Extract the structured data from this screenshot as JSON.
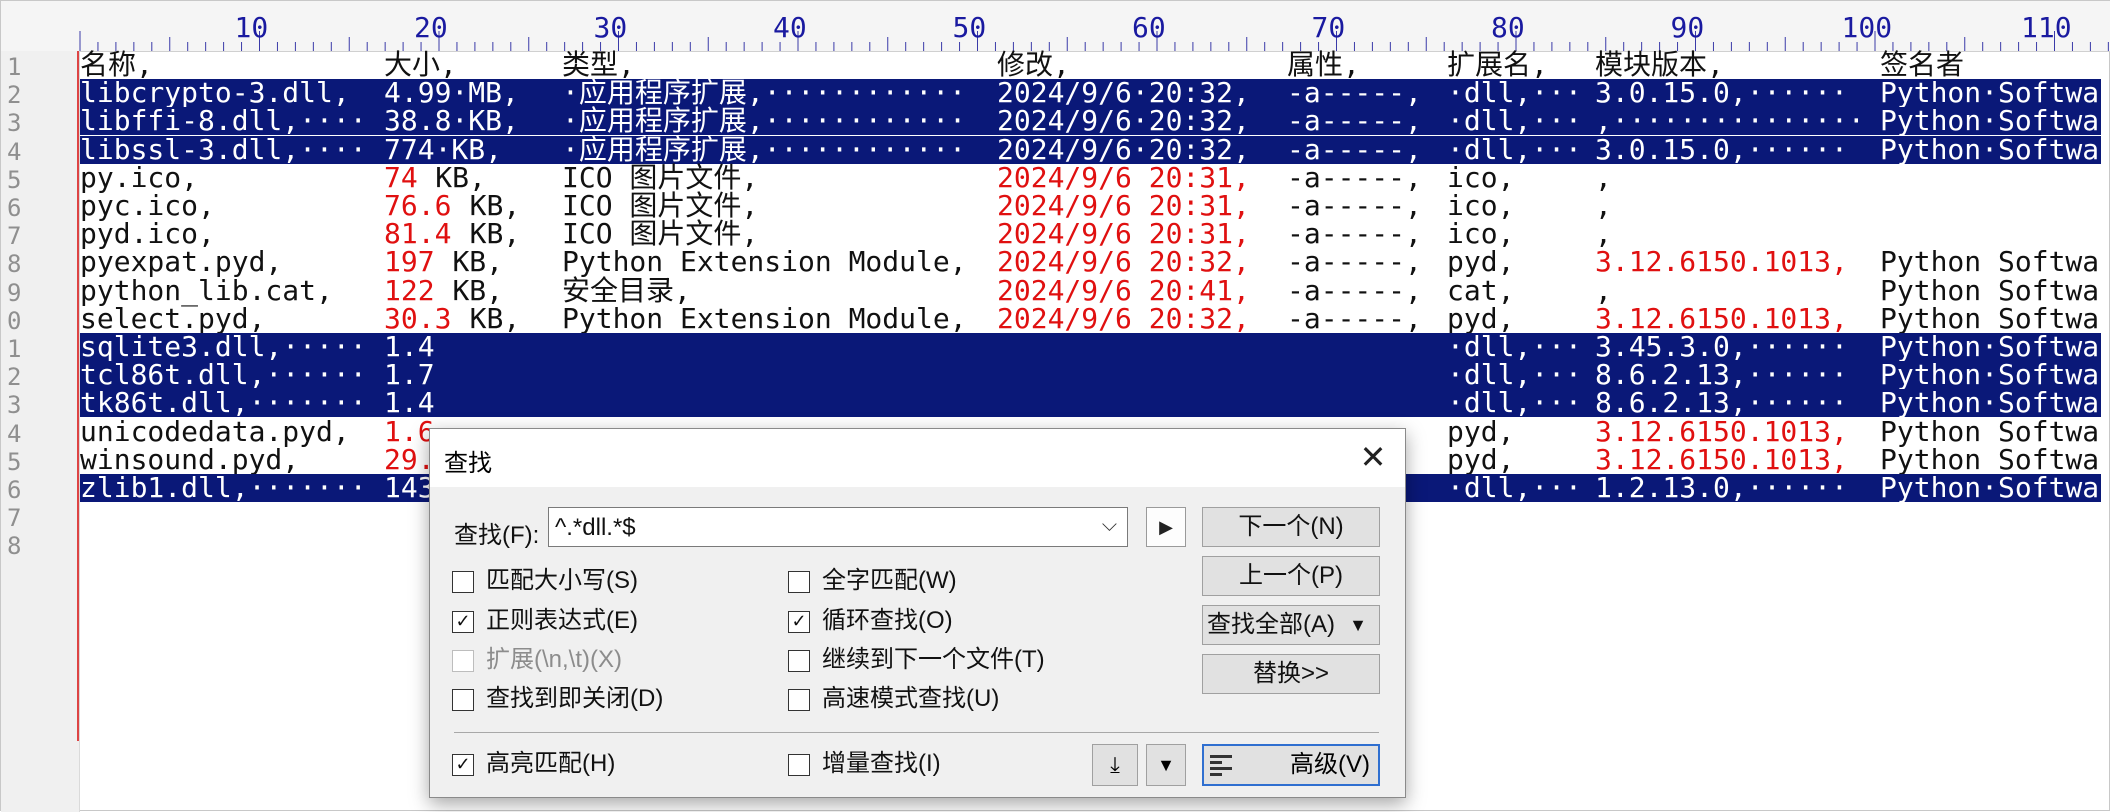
{
  "ruler": {
    "numbers": [
      "10",
      "20",
      "30",
      "40",
      "50",
      "60",
      "70",
      "80",
      "90",
      "100",
      "110"
    ]
  },
  "gutter": {
    "line_numbers": [
      "1",
      "2",
      "3",
      "4",
      "5",
      "6",
      "7",
      "8",
      "9",
      "0",
      "1",
      "2",
      "3",
      "4",
      "5",
      "6",
      "7",
      "8"
    ]
  },
  "rows": [
    {
      "sel": false,
      "name": "名称,",
      "size": "大小,",
      "type": "类型,",
      "mod": "修改,",
      "attr": "属性,",
      "ext": "扩展名,",
      "ver": "模块版本,",
      "sig": "签名者"
    },
    {
      "sel": true,
      "name": "libcrypto-3.dll,",
      "size": "4.99·MB,",
      "type": "·应用程序扩展,············",
      "mod": "2024/9/6·20:32,",
      "attr": "-a-----,",
      "ext": "·dll,···",
      "ver": "3.0.15.0,······",
      "sig": "Python·Softwa"
    },
    {
      "sel": true,
      "name": "libffi-8.dll,····",
      "size": "38.8·KB,",
      "type": "·应用程序扩展,············",
      "mod": "2024/9/6·20:32,",
      "attr": "-a-----,",
      "ext": "·dll,···",
      "ver": ",···············",
      "sig": "Python·Softwa"
    },
    {
      "sel": true,
      "name": "libssl-3.dll,····",
      "size": "774·KB,",
      "type": "·应用程序扩展,············",
      "mod": "2024/9/6·20:32,",
      "attr": "-a-----,",
      "ext": "·dll,···",
      "ver": "3.0.15.0,······",
      "sig": "Python·Softwa"
    },
    {
      "sel": false,
      "name": "py.ico,",
      "size": "74",
      "sizeu": " KB,",
      "type": "ICO 图片文件,",
      "mod": "2024/9/6 20:31,",
      "attr": "-a-----,",
      "ext": "ico,",
      "ver": ",",
      "sig": ""
    },
    {
      "sel": false,
      "name": "pyc.ico,",
      "size": "76.6",
      "sizeu": " KB,",
      "type": "ICO 图片文件,",
      "mod": "2024/9/6 20:31,",
      "attr": "-a-----,",
      "ext": "ico,",
      "ver": ",",
      "sig": ""
    },
    {
      "sel": false,
      "name": "pyd.ico,",
      "size": "81.4",
      "sizeu": " KB,",
      "type": "ICO 图片文件,",
      "mod": "2024/9/6 20:31,",
      "attr": "-a-----,",
      "ext": "ico,",
      "ver": ",",
      "sig": ""
    },
    {
      "sel": false,
      "name": "pyexpat.pyd,",
      "size": "197",
      "sizeu": " KB,",
      "type": "Python Extension Module,",
      "mod": "2024/9/6 20:32,",
      "attr": "-a-----,",
      "ext": "pyd,",
      "ver": "3.12.6150.1013,",
      "sig": "Python Softwa"
    },
    {
      "sel": false,
      "name": "python_lib.cat,",
      "size": "122",
      "sizeu": " KB,",
      "type": "安全目录,",
      "mod": "2024/9/6 20:41,",
      "attr": "-a-----,",
      "ext": "cat,",
      "ver": ",",
      "sig": "Python Softwa"
    },
    {
      "sel": false,
      "name": "select.pyd,",
      "size": "30.3",
      "sizeu": " KB,",
      "type": "Python Extension Module,",
      "mod": "2024/9/6 20:32,",
      "attr": "-a-----,",
      "ext": "pyd,",
      "ver": "3.12.6150.1013,",
      "sig": "Python Softwa"
    },
    {
      "sel": true,
      "name": "sqlite3.dll,·····",
      "size": "1.4",
      "type": "",
      "mod": "",
      "attr": "",
      "ext": "·dll,···",
      "ver": "3.45.3.0,······",
      "sig": "Python·Softwa"
    },
    {
      "sel": true,
      "name": "tcl86t.dll,······",
      "size": "1.7",
      "type": "",
      "mod": "",
      "attr": "",
      "ext": "·dll,···",
      "ver": "8.6.2.13,······",
      "sig": "Python·Softwa"
    },
    {
      "sel": true,
      "name": "tk86t.dll,·······",
      "size": "1.4",
      "type": "",
      "mod": "",
      "attr": "",
      "ext": "·dll,···",
      "ver": "8.6.2.13,······",
      "sig": "Python·Softwa"
    },
    {
      "sel": false,
      "name": "unicodedata.pyd,",
      "size": "1.6",
      "type": "",
      "mod": "",
      "attr": "",
      "ext": "pyd,",
      "ver": "3.12.6150.1013,",
      "sig": "Python Softwa"
    },
    {
      "sel": false,
      "name": "winsound.pyd,",
      "size": "29.",
      "type": "",
      "mod": "",
      "attr": "",
      "ext": "pyd,",
      "ver": "3.12.6150.1013,",
      "sig": "Python Softwa"
    },
    {
      "sel": true,
      "name": "zlib1.dll,·······",
      "size": "143",
      "type": "",
      "mod": "",
      "attr": "",
      "ext": "·dll,···",
      "ver": "1.2.13.0,······",
      "sig": "Python·Softwa"
    }
  ],
  "dialog": {
    "title": "查找",
    "close": "✕",
    "find_label": "查找(F):",
    "find_value": "^.*dll.*$",
    "next_btn": "下一个(N)",
    "prev_btn": "上一个(P)",
    "findall_btn": "查找全部(A)",
    "replace_btn": "替换>>",
    "advanced_btn": "高级(V)",
    "cb_match_case": "匹配大小写(S)",
    "cb_regex": "正则表达式(E)",
    "cb_extended": "扩展(\\n,\\t)(X)",
    "cb_close_on_find": "查找到即关闭(D)",
    "cb_whole_word": "全字匹配(W)",
    "cb_wrap": "循环查找(O)",
    "cb_next_file": "继续到下一个文件(T)",
    "cb_fast": "高速模式查找(U)",
    "cb_highlight": "高亮匹配(H)",
    "cb_incremental": "增量查找(I)"
  }
}
